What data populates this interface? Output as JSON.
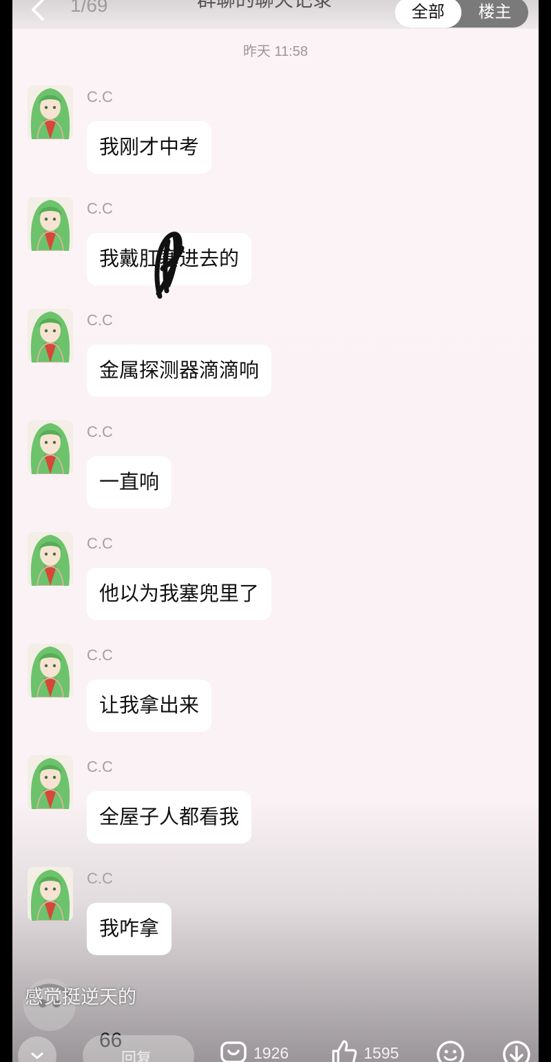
{
  "header": {
    "page_counter": "1/69",
    "title": "群聊的聊天记录",
    "tabs": [
      "全部",
      "楼主"
    ],
    "active_tab": 0
  },
  "timestamp": "昨天 11:58",
  "messages": [
    {
      "sender": "C.C",
      "text": "我刚才中考"
    },
    {
      "sender": "C.C",
      "text": "我戴肛塞进去的"
    },
    {
      "sender": "C.C",
      "text": "金属探测器滴滴响"
    },
    {
      "sender": "C.C",
      "text": "一直响"
    },
    {
      "sender": "C.C",
      "text": "他以为我塞兜里了"
    },
    {
      "sender": "C.C",
      "text": "让我拿出来"
    },
    {
      "sender": "C.C",
      "text": "全屋子人都看我"
    },
    {
      "sender": "C.C",
      "text": "我咋拿"
    }
  ],
  "overlay": {
    "danmaku": "感觉挺逆天的",
    "count": "66"
  },
  "bottom_bar": {
    "reply_label": "回复",
    "comments": "1926",
    "likes": "1595"
  },
  "icons": {
    "back": "chevron-left-icon",
    "comment": "comment-icon",
    "like": "thumbs-up-icon",
    "emoji": "smiley-icon",
    "download": "download-icon",
    "collapse": "chevron-down-icon"
  }
}
